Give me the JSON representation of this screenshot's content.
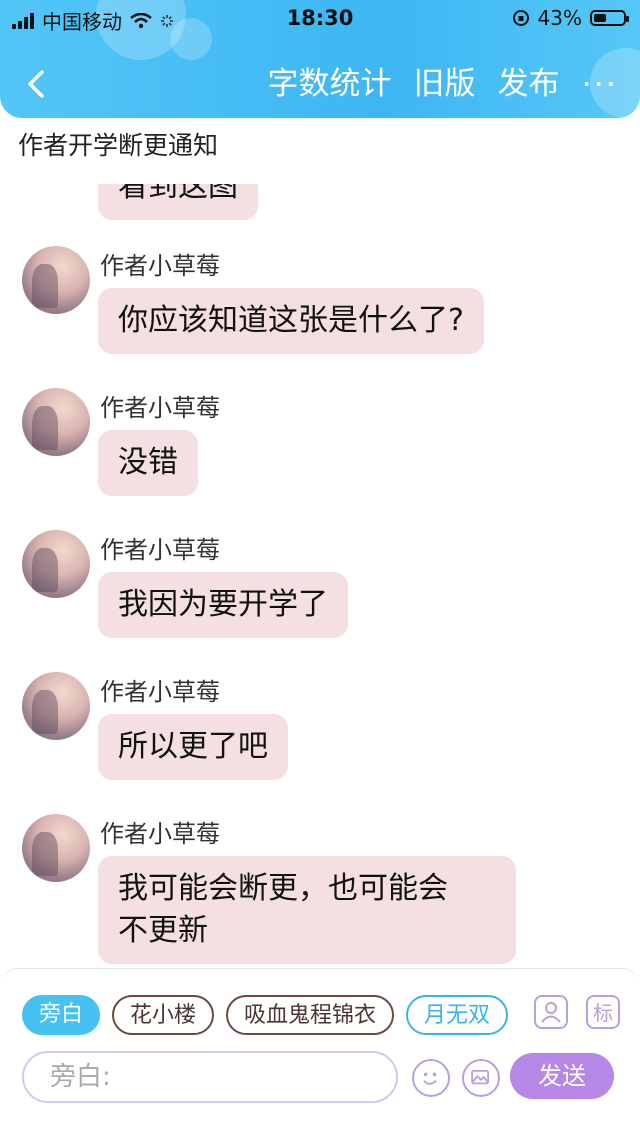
{
  "status_bar": {
    "carrier": "中国移动",
    "time": "18:30",
    "battery_percent": "43%",
    "battery_level": 0.43
  },
  "nav": {
    "back_icon": "chevron-left-icon",
    "word_count": "字数统计",
    "old_version": "旧版",
    "publish": "发布",
    "more": "···"
  },
  "notice_title": "作者开学断更通知",
  "messages": [
    {
      "name": "",
      "text": "看到这图"
    },
    {
      "name": "作者小草莓",
      "text": "你应该知道这张是什么了?"
    },
    {
      "name": "作者小草莓",
      "text": "没错"
    },
    {
      "name": "作者小草莓",
      "text": "我因为要开学了"
    },
    {
      "name": "作者小草莓",
      "text": "所以更了吧"
    },
    {
      "name": "作者小草莓",
      "text": "我可能会断更，也可能会\n不更新"
    }
  ],
  "input_bar": {
    "chips": [
      "旁白",
      "花小楼",
      "吸血鬼程锦衣",
      "月无双"
    ],
    "avatar_icon_label": "",
    "tag_icon_label": "标",
    "placeholder": "旁白:",
    "send_label": "发送"
  }
}
